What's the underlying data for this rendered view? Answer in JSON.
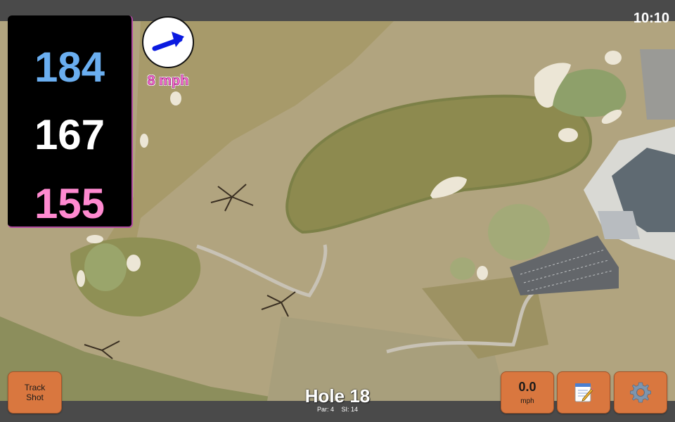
{
  "status_bar": {
    "time": "10:10"
  },
  "distances": {
    "back": "184",
    "middle": "167",
    "front": "155"
  },
  "wind": {
    "speed": "8 mph",
    "direction_icon": "wind-arrow-icon"
  },
  "hole": {
    "title": "Hole 18",
    "par": "Par: 4",
    "stroke_index": "SI: 14"
  },
  "buttons": {
    "track_shot": "Track\nShot",
    "speed_value": "0.0",
    "speed_unit": "mph",
    "notes_icon": "notepad-icon",
    "settings_icon": "gear-icon"
  },
  "colors": {
    "back": "#6aaef0",
    "middle": "#ffffff",
    "front": "#ff8ad0",
    "button": "#d9773f",
    "wind_text": "#ff6cd0",
    "arrow": "#0a1ae0"
  }
}
